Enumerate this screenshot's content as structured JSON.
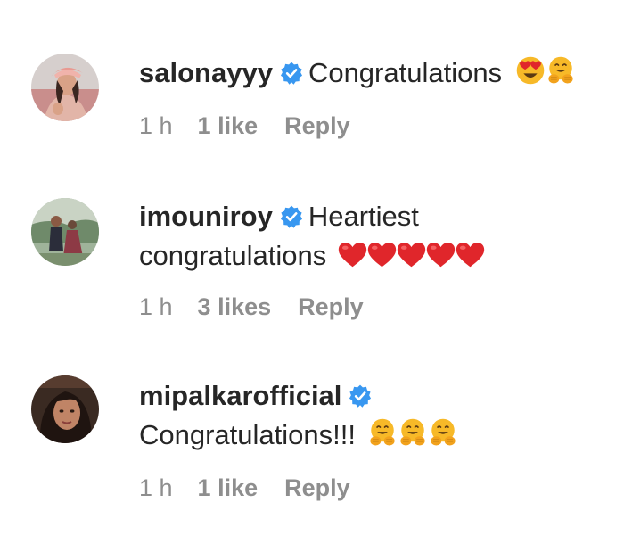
{
  "comments": [
    {
      "username": "salonayyy",
      "verified": true,
      "text": "Congratulations",
      "emojis": [
        "heart-eyes-emoji",
        "hugging-face-emoji"
      ],
      "time": "1 h",
      "likes": "1 like",
      "reply_label": "Reply"
    },
    {
      "username": "imouniroy",
      "verified": true,
      "text_line1": "Heartiest",
      "text_line2": "congratulations",
      "emojis": [
        "red-heart-emoji",
        "red-heart-emoji",
        "red-heart-emoji",
        "red-heart-emoji",
        "red-heart-emoji"
      ],
      "time": "1 h",
      "likes": "3 likes",
      "reply_label": "Reply"
    },
    {
      "username": "mipalkarofficial",
      "verified": true,
      "text": "Congratulations!!!",
      "emojis": [
        "hugging-face-emoji",
        "hugging-face-emoji",
        "hugging-face-emoji"
      ],
      "time": "1 h",
      "likes": "1 like",
      "reply_label": "Reply"
    }
  ],
  "colors": {
    "text": "#262626",
    "meta": "#8e8e8e",
    "verified_badge": "#3897f0",
    "heart": "#e0262b",
    "emoji_face": "#f7b928"
  }
}
